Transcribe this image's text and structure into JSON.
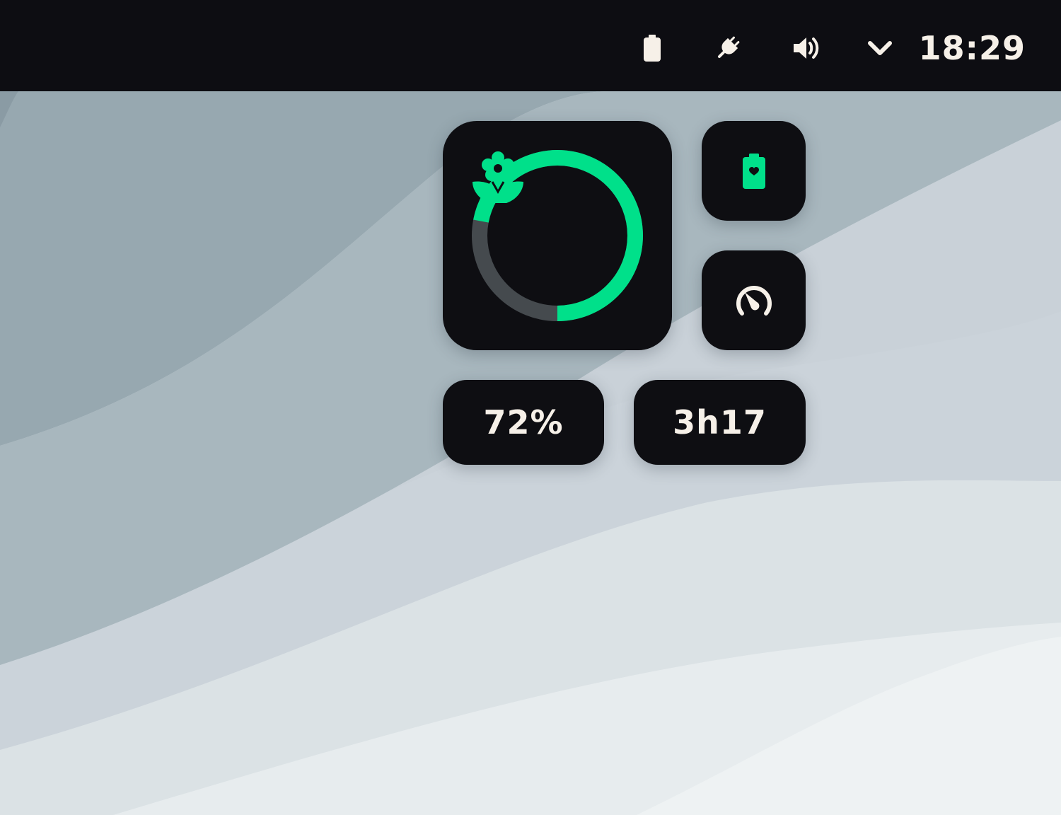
{
  "topbar": {
    "icons": [
      "battery-icon",
      "power-plug-icon",
      "volume-icon",
      "chevron-down-icon"
    ],
    "clock": "18:29"
  },
  "widget": {
    "battery_level": 0.72,
    "center_icon": "flower-eco-icon",
    "percent_label": "72%",
    "time_remaining": "3h17",
    "health_icon": "battery-heart-icon",
    "performance_icon": "speedometer-icon"
  },
  "colors": {
    "accent": "#00e08a",
    "ring_track": "#454a4e",
    "tile_bg": "#0e0e12",
    "topbar_bg": "#0d0d12",
    "text": "#f6f0e8"
  }
}
